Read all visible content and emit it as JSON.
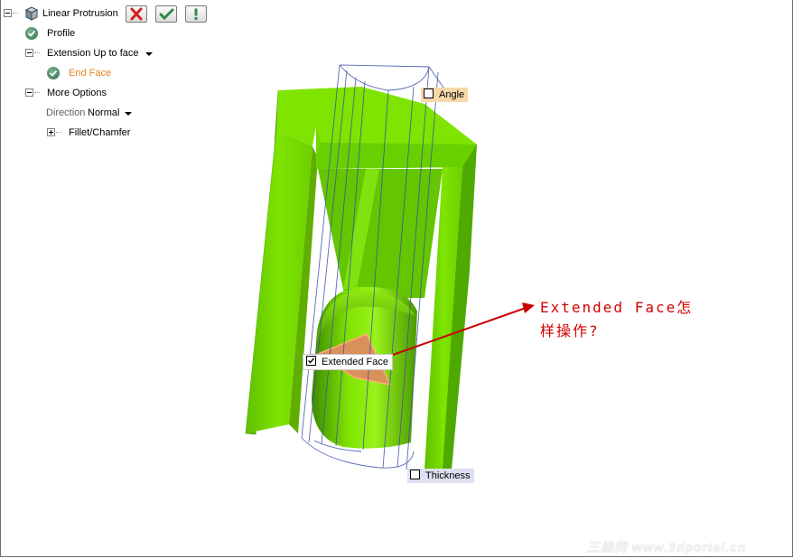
{
  "feature_tree": {
    "title": "Linear Protrusion",
    "buttons": {
      "cancel": "cancel-x-icon",
      "ok": "ok-check-icon",
      "preview": "preview-exclamation-icon"
    },
    "items": {
      "profile": "Profile",
      "extension": "Extension Up to face",
      "end_face": "End Face",
      "more_options": "More Options",
      "direction_label": "Direction",
      "direction_value": "Normal",
      "fillet": "Fillet/Chamfer"
    }
  },
  "viewport": {
    "angle_label": "Angle",
    "angle_checked": false,
    "extended_face_label": "Extended Face",
    "extended_face_checked": true,
    "thickness_label": "Thickness",
    "thickness_checked": false
  },
  "annotation": {
    "text": "Extended Face怎样操作?",
    "color": "#cc0000"
  },
  "watermark": "三维网 www.3dportal.cn",
  "colors": {
    "model_green": "#7fe400",
    "selected_face": "#d9905a",
    "end_face_text": "#e8821e",
    "angle_tag_bg": "#f8d8a8",
    "thickness_tag_bg": "#dde0f0"
  }
}
